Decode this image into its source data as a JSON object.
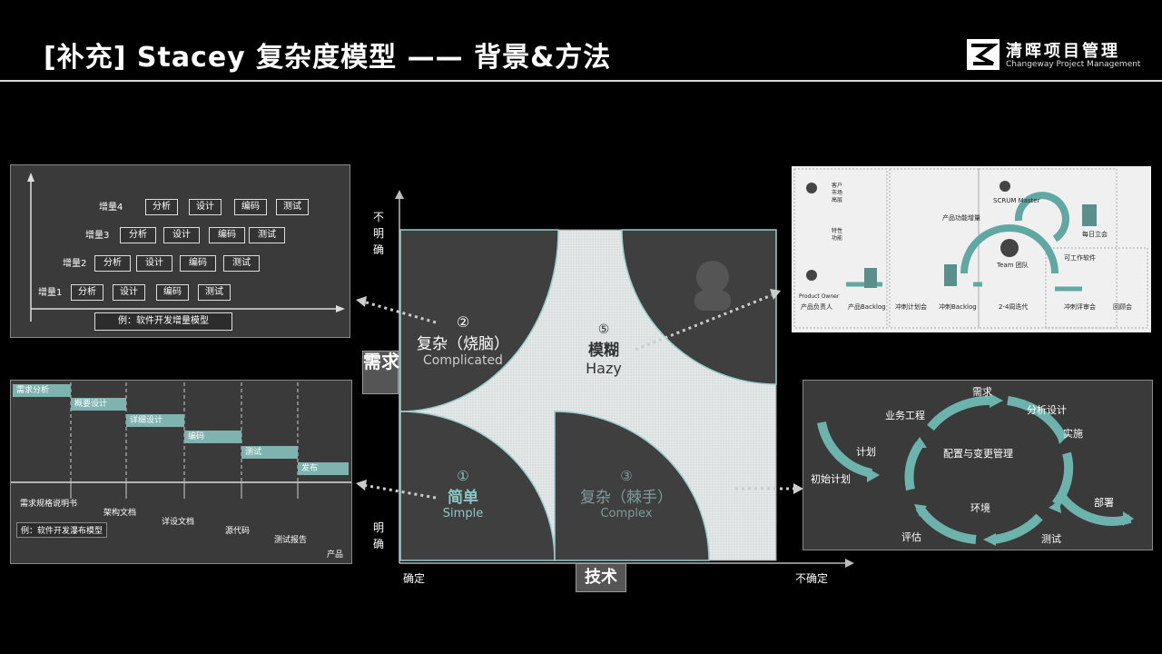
{
  "header": {
    "title": "[补充] Stacey 复杂度模型 —— 背景&方法",
    "logo_cn": "清晖项目管理",
    "logo_en": "Changeway Project Management"
  },
  "matrix": {
    "y_axis_label": "需求",
    "x_axis_label": "技术",
    "y_top": "不明确",
    "y_bottom": "明确",
    "x_left": "确定",
    "x_right": "不确定",
    "zones": {
      "complicated": {
        "num": "②",
        "cn": "复杂（烧脑）",
        "en": "Complicated"
      },
      "hazy": {
        "num": "⑤",
        "cn": "模糊",
        "en": "Hazy"
      },
      "simple": {
        "num": "①",
        "cn": "简单",
        "en": "Simple"
      },
      "complex": {
        "num": "③",
        "cn": "复杂（棘手）",
        "en": "Complex"
      }
    }
  },
  "incremental": {
    "rows": [
      {
        "label": "增量4",
        "steps": [
          "分析",
          "设计",
          "编码",
          "测试"
        ]
      },
      {
        "label": "增量3",
        "steps": [
          "分析",
          "设计",
          "编码",
          "测试"
        ]
      },
      {
        "label": "增量2",
        "steps": [
          "分析",
          "设计",
          "编码",
          "测试"
        ]
      },
      {
        "label": "增量1",
        "steps": [
          "分析",
          "设计",
          "编码",
          "测试"
        ]
      }
    ],
    "caption": "例：软件开发增量模型"
  },
  "waterfall": {
    "stages": [
      "需求分析",
      "概要设计",
      "详细设计",
      "编码",
      "测试",
      "发布"
    ],
    "outputs": [
      "需求规格说明书",
      "架构文档",
      "详设文档",
      "源代码",
      "测试报告",
      "产品"
    ],
    "caption": "例：软件开发瀑布模型"
  },
  "scrum": {
    "labels": [
      "客户",
      "市场",
      "高层",
      "特性",
      "功能",
      "Product Owner",
      "产品负责人",
      "产品Backlog",
      "冲刺计划会",
      "冲刺Backlog",
      "产品功能增量",
      "SCRUM Master",
      "Team 团队",
      "2-4周迭代",
      "每日立会",
      "可工作软件",
      "冲刺评审会",
      "回顾会"
    ]
  },
  "cycle": {
    "center": "配置与变更管理",
    "labels": [
      "需求",
      "分析设计",
      "实施",
      "业务工程",
      "计划",
      "初始计划",
      "环境",
      "评估",
      "测试",
      "部署"
    ]
  },
  "colors": {
    "accent": "#5fa8a3",
    "dark": "#3c3c3c",
    "light": "#e9eeee"
  }
}
